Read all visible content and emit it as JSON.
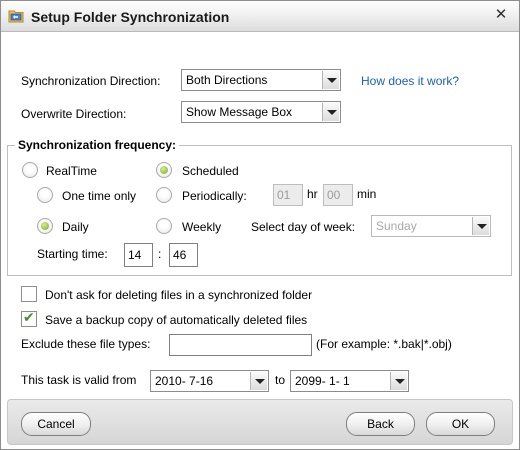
{
  "window": {
    "title": "Setup Folder Synchronization",
    "close_glyph": "✕"
  },
  "direction": {
    "sync_label": "Synchronization Direction:",
    "sync_value": "Both Directions",
    "help_link": "How does it work?",
    "overwrite_label": "Overwrite Direction:",
    "overwrite_value": "Show Message Box"
  },
  "frequency": {
    "title": "Synchronization frequency:",
    "realtime": {
      "label": "RealTime",
      "checked": false
    },
    "scheduled": {
      "label": "Scheduled",
      "checked": true
    },
    "one_time": {
      "label": "One time only",
      "checked": false
    },
    "periodically": {
      "label": "Periodically:",
      "checked": false
    },
    "hours_value": "01",
    "hours_unit": "hr",
    "minutes_value": "00",
    "minutes_unit": "min",
    "daily": {
      "label": "Daily",
      "checked": true
    },
    "weekly": {
      "label": "Weekly",
      "checked": false
    },
    "day_of_week_label": "Select day of week:",
    "day_of_week_value": "Sunday",
    "starting_time_label": "Starting time:",
    "start_hour": "14",
    "time_separator": ":",
    "start_minute": "46"
  },
  "options": {
    "dont_ask": {
      "label": "Don't ask for deleting files in a synchronized folder",
      "checked": false
    },
    "backup": {
      "label": "Save a backup copy of automatically deleted files",
      "checked": true
    },
    "exclude_label": "Exclude these file types:",
    "exclude_value": "",
    "exclude_hint": "(For example: *.bak|*.obj)",
    "valid_from_label": "This task is valid from",
    "valid_from_value": "2010- 7-16",
    "valid_to_label": "to",
    "valid_to_value": "2099- 1- 1"
  },
  "buttons": {
    "cancel": "Cancel",
    "back": "Back",
    "ok": "OK"
  },
  "colors": {
    "link": "#1b5fb8",
    "radio_checked": "#7fa52a",
    "check_mark": "#3f8f2e"
  }
}
